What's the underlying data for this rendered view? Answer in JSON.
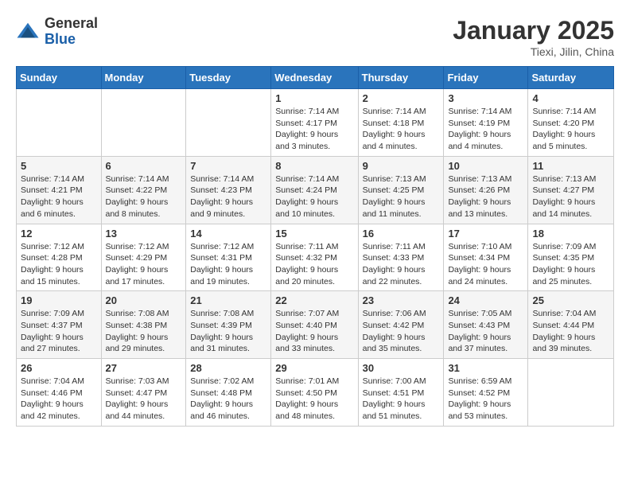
{
  "header": {
    "logo_general": "General",
    "logo_blue": "Blue",
    "month_title": "January 2025",
    "location": "Tiexi, Jilin, China"
  },
  "days_of_week": [
    "Sunday",
    "Monday",
    "Tuesday",
    "Wednesday",
    "Thursday",
    "Friday",
    "Saturday"
  ],
  "weeks": [
    [
      {
        "num": "",
        "info": ""
      },
      {
        "num": "",
        "info": ""
      },
      {
        "num": "",
        "info": ""
      },
      {
        "num": "1",
        "info": "Sunrise: 7:14 AM\nSunset: 4:17 PM\nDaylight: 9 hours\nand 3 minutes."
      },
      {
        "num": "2",
        "info": "Sunrise: 7:14 AM\nSunset: 4:18 PM\nDaylight: 9 hours\nand 4 minutes."
      },
      {
        "num": "3",
        "info": "Sunrise: 7:14 AM\nSunset: 4:19 PM\nDaylight: 9 hours\nand 4 minutes."
      },
      {
        "num": "4",
        "info": "Sunrise: 7:14 AM\nSunset: 4:20 PM\nDaylight: 9 hours\nand 5 minutes."
      }
    ],
    [
      {
        "num": "5",
        "info": "Sunrise: 7:14 AM\nSunset: 4:21 PM\nDaylight: 9 hours\nand 6 minutes."
      },
      {
        "num": "6",
        "info": "Sunrise: 7:14 AM\nSunset: 4:22 PM\nDaylight: 9 hours\nand 8 minutes."
      },
      {
        "num": "7",
        "info": "Sunrise: 7:14 AM\nSunset: 4:23 PM\nDaylight: 9 hours\nand 9 minutes."
      },
      {
        "num": "8",
        "info": "Sunrise: 7:14 AM\nSunset: 4:24 PM\nDaylight: 9 hours\nand 10 minutes."
      },
      {
        "num": "9",
        "info": "Sunrise: 7:13 AM\nSunset: 4:25 PM\nDaylight: 9 hours\nand 11 minutes."
      },
      {
        "num": "10",
        "info": "Sunrise: 7:13 AM\nSunset: 4:26 PM\nDaylight: 9 hours\nand 13 minutes."
      },
      {
        "num": "11",
        "info": "Sunrise: 7:13 AM\nSunset: 4:27 PM\nDaylight: 9 hours\nand 14 minutes."
      }
    ],
    [
      {
        "num": "12",
        "info": "Sunrise: 7:12 AM\nSunset: 4:28 PM\nDaylight: 9 hours\nand 15 minutes."
      },
      {
        "num": "13",
        "info": "Sunrise: 7:12 AM\nSunset: 4:29 PM\nDaylight: 9 hours\nand 17 minutes."
      },
      {
        "num": "14",
        "info": "Sunrise: 7:12 AM\nSunset: 4:31 PM\nDaylight: 9 hours\nand 19 minutes."
      },
      {
        "num": "15",
        "info": "Sunrise: 7:11 AM\nSunset: 4:32 PM\nDaylight: 9 hours\nand 20 minutes."
      },
      {
        "num": "16",
        "info": "Sunrise: 7:11 AM\nSunset: 4:33 PM\nDaylight: 9 hours\nand 22 minutes."
      },
      {
        "num": "17",
        "info": "Sunrise: 7:10 AM\nSunset: 4:34 PM\nDaylight: 9 hours\nand 24 minutes."
      },
      {
        "num": "18",
        "info": "Sunrise: 7:09 AM\nSunset: 4:35 PM\nDaylight: 9 hours\nand 25 minutes."
      }
    ],
    [
      {
        "num": "19",
        "info": "Sunrise: 7:09 AM\nSunset: 4:37 PM\nDaylight: 9 hours\nand 27 minutes."
      },
      {
        "num": "20",
        "info": "Sunrise: 7:08 AM\nSunset: 4:38 PM\nDaylight: 9 hours\nand 29 minutes."
      },
      {
        "num": "21",
        "info": "Sunrise: 7:08 AM\nSunset: 4:39 PM\nDaylight: 9 hours\nand 31 minutes."
      },
      {
        "num": "22",
        "info": "Sunrise: 7:07 AM\nSunset: 4:40 PM\nDaylight: 9 hours\nand 33 minutes."
      },
      {
        "num": "23",
        "info": "Sunrise: 7:06 AM\nSunset: 4:42 PM\nDaylight: 9 hours\nand 35 minutes."
      },
      {
        "num": "24",
        "info": "Sunrise: 7:05 AM\nSunset: 4:43 PM\nDaylight: 9 hours\nand 37 minutes."
      },
      {
        "num": "25",
        "info": "Sunrise: 7:04 AM\nSunset: 4:44 PM\nDaylight: 9 hours\nand 39 minutes."
      }
    ],
    [
      {
        "num": "26",
        "info": "Sunrise: 7:04 AM\nSunset: 4:46 PM\nDaylight: 9 hours\nand 42 minutes."
      },
      {
        "num": "27",
        "info": "Sunrise: 7:03 AM\nSunset: 4:47 PM\nDaylight: 9 hours\nand 44 minutes."
      },
      {
        "num": "28",
        "info": "Sunrise: 7:02 AM\nSunset: 4:48 PM\nDaylight: 9 hours\nand 46 minutes."
      },
      {
        "num": "29",
        "info": "Sunrise: 7:01 AM\nSunset: 4:50 PM\nDaylight: 9 hours\nand 48 minutes."
      },
      {
        "num": "30",
        "info": "Sunrise: 7:00 AM\nSunset: 4:51 PM\nDaylight: 9 hours\nand 51 minutes."
      },
      {
        "num": "31",
        "info": "Sunrise: 6:59 AM\nSunset: 4:52 PM\nDaylight: 9 hours\nand 53 minutes."
      },
      {
        "num": "",
        "info": ""
      }
    ]
  ]
}
